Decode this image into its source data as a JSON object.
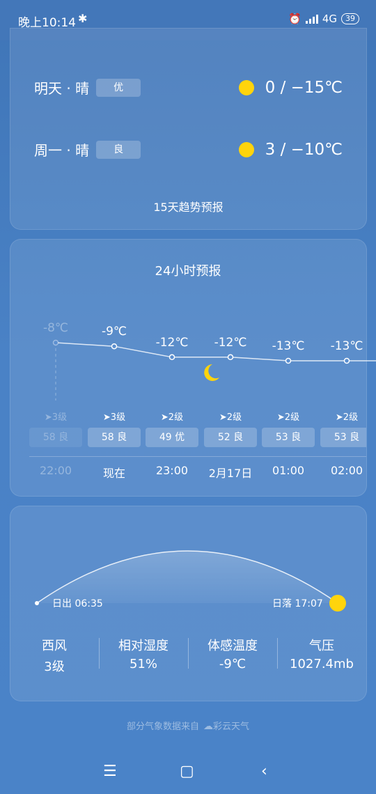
{
  "status_bar": {
    "time": "晚上10:14",
    "bluetooth": "bluetooth-icon",
    "network": "4G",
    "battery": "39"
  },
  "daily": [
    {
      "day": "明天 · 晴",
      "aqi": "优",
      "temps": "0  /  −15℃"
    },
    {
      "day": "周一 · 晴",
      "aqi": "良",
      "temps": "3  /  −10℃"
    }
  ],
  "trend_link": "15天趋势预报",
  "hourly": {
    "title": "24小时预报",
    "items": [
      {
        "temp": "-8℃",
        "temp_value": -8,
        "wind": "➤3级",
        "aqi": "58 良",
        "time": "22:00",
        "faded": true
      },
      {
        "temp": "-9℃",
        "temp_value": -9,
        "wind": "➤3级",
        "aqi": "58 良",
        "time": "现在"
      },
      {
        "temp": "-12℃",
        "temp_value": -12,
        "wind": "➤2级",
        "aqi": "49 优",
        "time": "23:00"
      },
      {
        "temp": "-12℃",
        "temp_value": -12,
        "wind": "➤2级",
        "aqi": "52 良",
        "time": "2月17日"
      },
      {
        "temp": "-13℃",
        "temp_value": -13,
        "wind": "➤2级",
        "aqi": "53 良",
        "time": "01:00"
      },
      {
        "temp": "-13℃",
        "temp_value": -13,
        "wind": "➤2级",
        "aqi": "53 良",
        "time": "02:00"
      }
    ]
  },
  "sun": {
    "sunrise": "日出 06:35",
    "sunset": "日落 17:07"
  },
  "stats": [
    {
      "label": "西风",
      "value": "3级"
    },
    {
      "label": "相对湿度",
      "value": "51%"
    },
    {
      "label": "体感温度",
      "value": "-9℃"
    },
    {
      "label": "气压",
      "value": "1027.4mb"
    }
  ],
  "credit": {
    "text": "部分气象数据来自",
    "source": "彩云天气"
  },
  "nav": {
    "menu": "☰",
    "home": "▢",
    "back": "‹"
  },
  "colors": {
    "sun": "#ffd40c",
    "background": "#4a82c6"
  }
}
